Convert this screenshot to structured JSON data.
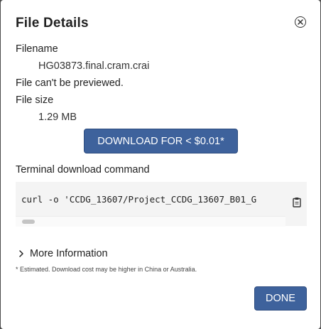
{
  "dialog": {
    "title": "File Details",
    "filename_label": "Filename",
    "filename_value": "HG03873.final.cram.crai",
    "preview_note": "File can't be previewed.",
    "filesize_label": "File size",
    "filesize_value": "1.29 MB",
    "download_button": "DOWNLOAD FOR < $0.01*",
    "terminal_label": "Terminal download command",
    "terminal_command": "curl -o 'CCDG_13607/Project_CCDG_13607_B01_G",
    "more_info": "More Information",
    "footnote": "* Estimated. Download cost may be higher in China or Australia.",
    "done_button": "DONE"
  },
  "icons": {
    "close": "close-circle-icon",
    "copy": "clipboard-icon",
    "expand": "chevron-right-icon"
  },
  "colors": {
    "primary_button": "#3e629c",
    "command_background": "#f4f4f4"
  }
}
